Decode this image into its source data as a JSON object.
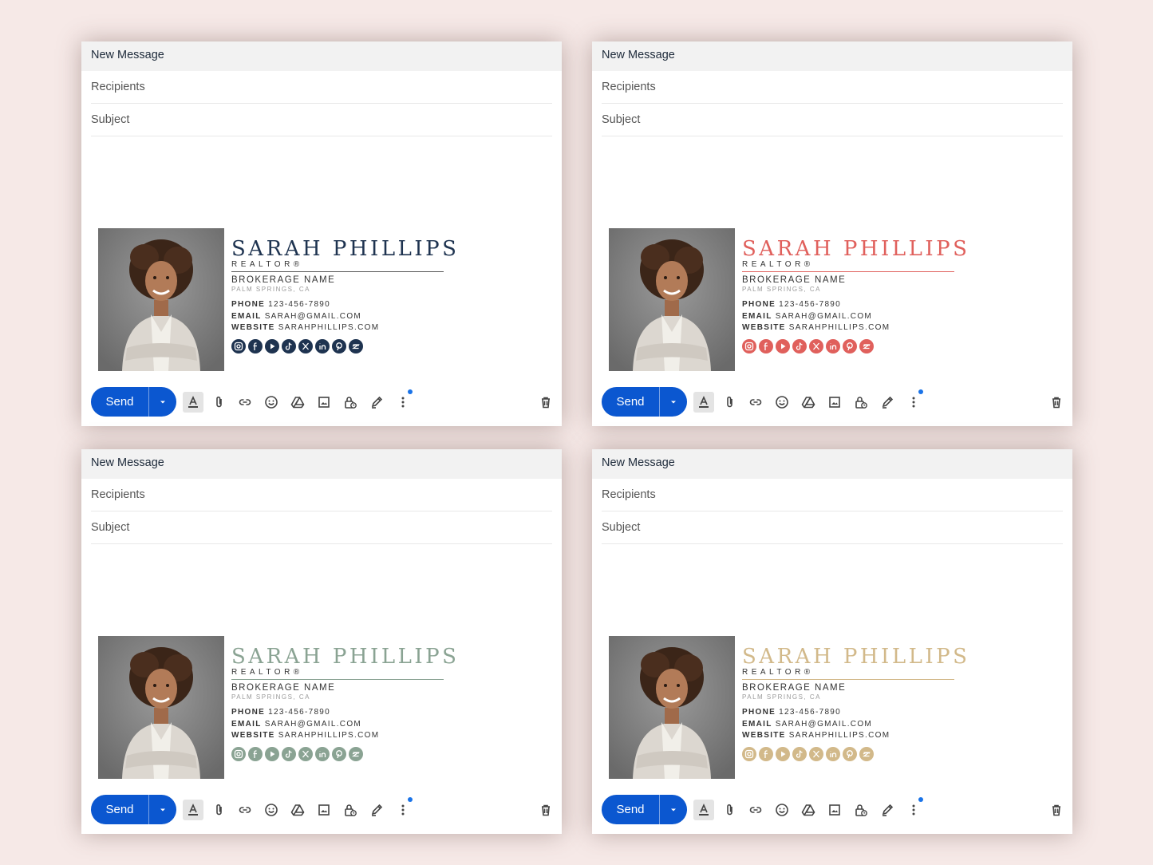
{
  "compose": {
    "title": "New Message",
    "recipients_placeholder": "Recipients",
    "subject_placeholder": "Subject",
    "send_label": "Send"
  },
  "signature": {
    "name": "SARAH PHILLIPS",
    "title": "REALTOR®",
    "brokerage": "BROKERAGE NAME",
    "location": "PALM SPRINGS, CA",
    "phone_label": "PHONE",
    "phone": "123-456-7890",
    "email_label": "EMAIL",
    "email": "SARAH@GMAIL.COM",
    "website_label": "WEBSITE",
    "website": "SARAHPHILLIPS.COM",
    "social_icons": [
      "instagram-icon",
      "facebook-icon",
      "youtube-icon",
      "tiktok-icon",
      "x-icon",
      "linkedin-icon",
      "pinterest-icon",
      "zillow-icon"
    ]
  },
  "variants": [
    {
      "accent": "#1e3350"
    },
    {
      "accent": "#e0605c"
    },
    {
      "accent": "#8aa393"
    },
    {
      "accent": "#d2b98a"
    }
  ],
  "toolbar_icons": [
    "format-text-icon",
    "attach-icon",
    "link-icon",
    "emoji-icon",
    "drive-icon",
    "image-icon",
    "lock-clock-icon",
    "pen-icon",
    "more-icon",
    "trash-icon"
  ]
}
